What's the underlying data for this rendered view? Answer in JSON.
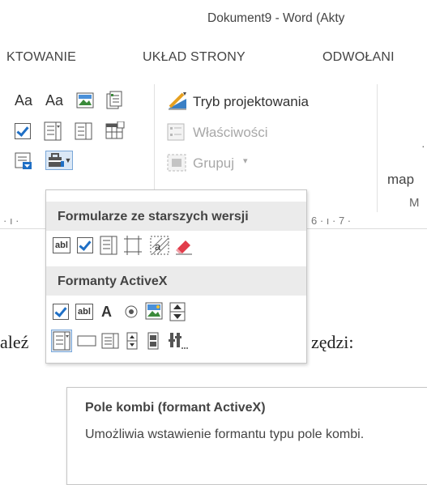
{
  "window": {
    "title": "Dokument9 - Word (Akty"
  },
  "tabs": [
    "KTOWANIE",
    "UKŁAD STRONY",
    "ODWOŁANI"
  ],
  "ribbon": {
    "design_mode": "Tryb projektowania",
    "properties": "Właściwości",
    "group": "Grupuj",
    "group_arrow": "▾",
    "aa1": "Aa",
    "aa2": "Aa",
    "right_cut_1": "map",
    "right_cut_2": "M",
    "right_cut_3": "·"
  },
  "ruler": {
    "left": "· ı ·",
    "right": "6 · ı · 7 ·"
  },
  "dropdown": {
    "legacy_header": "Formularze ze starszych wersji",
    "activex_header": "Formanty ActiveX",
    "abl_label": "abl",
    "label_a": "A"
  },
  "document": {
    "left_text": "aleź",
    "right_text": "zędzi:"
  },
  "tooltip": {
    "title": "Pole kombi (formant ActiveX)",
    "description": "Umożliwia wstawienie formantu typu pole kombi."
  },
  "colors": {
    "accent_blue": "#1f6fc5",
    "header_gray": "#ebebeb",
    "selected_border": "#7aa7d8"
  }
}
